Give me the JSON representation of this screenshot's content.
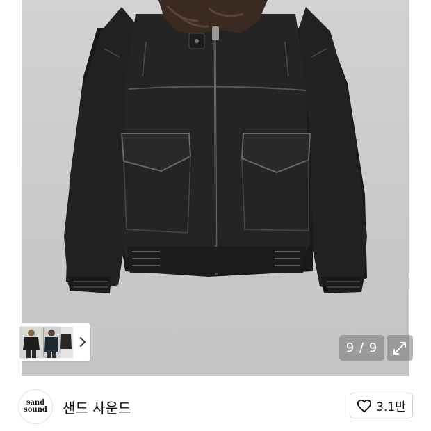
{
  "gallery": {
    "image_alt": "black leather bomber jacket with brown fur collar",
    "page_counter": "9 / 9",
    "thumbnail_next_icon": "chevron-right-icon",
    "expand_icon": "expand-icon"
  },
  "store": {
    "logo_line1": "sand",
    "logo_line2": "sound",
    "name": "샌드 사운드",
    "like_icon": "heart-outline-icon",
    "like_count": "3.1만"
  },
  "colors": {
    "background": "#ffffff",
    "gallery_bg": "#cbcbcd",
    "jacket": "#1f1d1c",
    "fur_collar": "#3a2a22",
    "overlay": "#78787a"
  }
}
